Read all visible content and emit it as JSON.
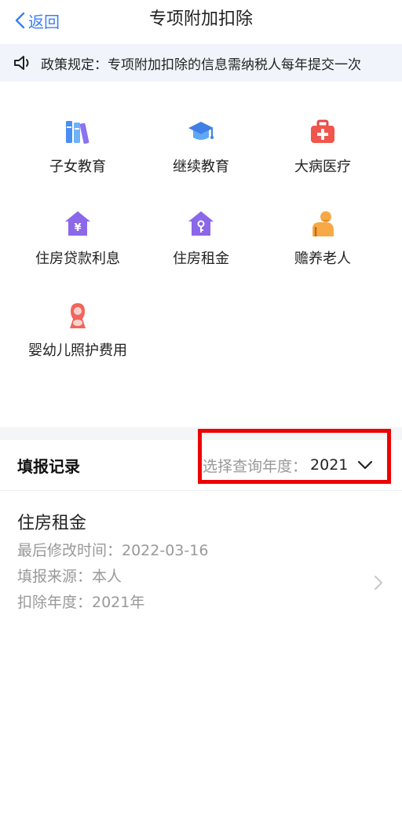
{
  "navbar": {
    "back_label": "返回",
    "title": "专项附加扣除"
  },
  "notice": {
    "icon": "speaker-icon",
    "text": "政策规定：专项附加扣除的信息需纳税人每年提交一次"
  },
  "categories": [
    {
      "label": "子女教育",
      "icon": "books-icon"
    },
    {
      "label": "继续教育",
      "icon": "graduation-cap-icon"
    },
    {
      "label": "大病医疗",
      "icon": "medical-kit-icon"
    },
    {
      "label": "住房贷款利息",
      "icon": "house-yen-icon"
    },
    {
      "label": "住房租金",
      "icon": "house-key-icon"
    },
    {
      "label": "赡养老人",
      "icon": "elderly-person-icon"
    },
    {
      "label": "婴幼儿照护费用",
      "icon": "mother-baby-icon"
    }
  ],
  "records": {
    "title": "填报记录",
    "year_select": {
      "label": "选择查询年度：",
      "value": "2021",
      "icon": "chevron-down-icon"
    },
    "items": [
      {
        "name": "住房租金",
        "modified": "最后修改时间：2022-03-16",
        "source": "填报来源：本人",
        "deduct_year": "扣除年度：2021年",
        "icon": "chevron-right-icon"
      }
    ]
  },
  "colors": {
    "accent": "#3a7ff5",
    "highlight_box": "#ee0000",
    "notice_bg": "#f1f5fb"
  }
}
